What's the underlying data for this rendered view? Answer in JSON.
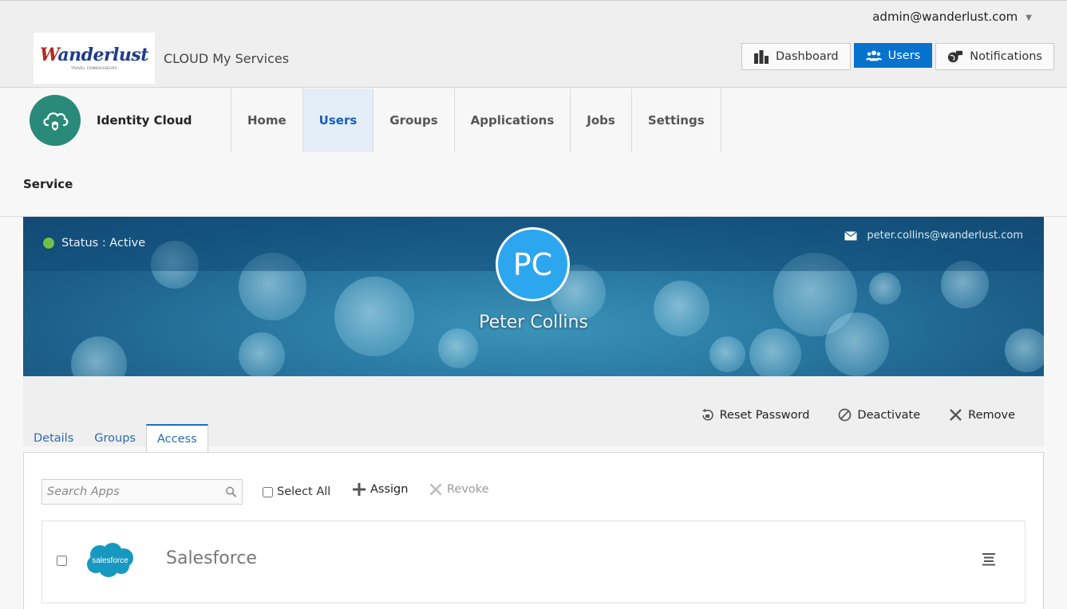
{
  "header": {
    "user_email": "admin@wanderlust.com",
    "logo": {
      "brand": "Wanderlust",
      "tagline": "TRAVEL CONNOISSEURS"
    },
    "app_title": "CLOUD My Services",
    "nav": [
      {
        "label": "Dashboard",
        "icon": "bar-chart-icon"
      },
      {
        "label": "Users",
        "icon": "users-icon",
        "active": true
      },
      {
        "label": "Notifications",
        "icon": "globe-chat-icon"
      }
    ]
  },
  "service": {
    "name": "Identity Cloud",
    "icon": "cloud-lock-icon",
    "tabs": [
      "Home",
      "Users",
      "Groups",
      "Applications",
      "Jobs",
      "Settings"
    ],
    "active_tab": "Users",
    "section_label": "Service"
  },
  "profile": {
    "status": "Status : Active",
    "email": "peter.collins@wanderlust.com",
    "initials": "PC",
    "name": "Peter Collins",
    "actions": [
      "Reset Password",
      "Deactivate",
      "Remove"
    ],
    "tabs": [
      "Details",
      "Groups",
      "Access"
    ],
    "active_tab": "Access"
  },
  "access": {
    "search_placeholder": "Search Apps",
    "select_all_label": "Select All",
    "assign_label": "Assign",
    "revoke_label": "Revoke",
    "apps": [
      {
        "name": "Salesforce",
        "logo_text": "salesforce"
      }
    ]
  },
  "colors": {
    "primary": "#0572ce",
    "service_icon": "#2a8a79",
    "avatar": "#2da6f0",
    "status_active": "#6ec04a",
    "salesforce": "#1798c1"
  }
}
